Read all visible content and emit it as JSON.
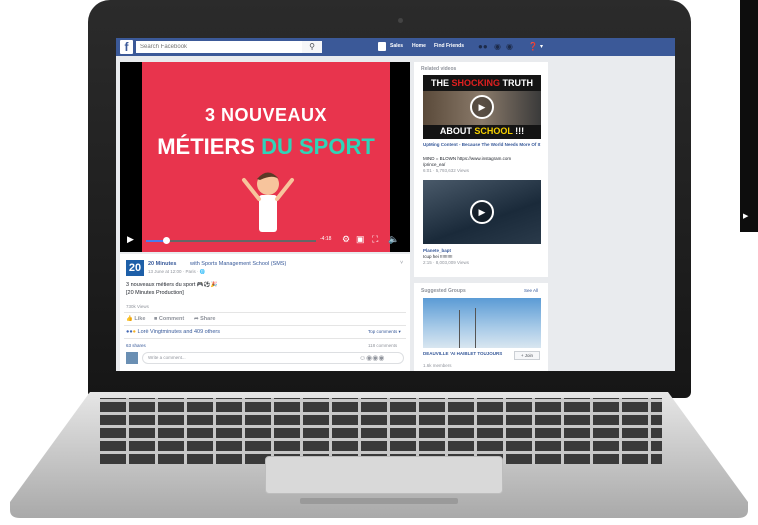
{
  "topbar": {
    "logo": "f",
    "search_placeholder": "Search Facebook",
    "search_icon": "search-icon",
    "user_label": "Sales",
    "home": "Home",
    "find_friends": "Find Friends"
  },
  "video": {
    "line1": "3 NOUVEAUX",
    "line2a": "MÉTIERS",
    "line2b": "DU SPORT",
    "time": "-4:18",
    "progress": 0.12
  },
  "post": {
    "page_logo": "20",
    "author": "20 Minutes",
    "with_text": "with Sports Management School (SMS)",
    "meta": "13 June at 12:00 · Paris · 🌐",
    "text1": "3 nouveaux métiers du sport 🎮⚽🎉",
    "text2": "[20 Minutes Production]",
    "views": "730k Views",
    "like": "Like",
    "comment": "Comment",
    "share": "Share",
    "reactions": "Lorè Vingtminutes and 409 others",
    "top_comments": "Top comments ▾",
    "shares": "63 shares",
    "comments_count": "118 comments",
    "write_comment": "Write a comment..."
  },
  "related": {
    "heading": "Related videos",
    "v1_top1": "THE ",
    "v1_top2": "SHOCKING",
    "v1_top3": " TRUTH",
    "v1_bottom1": "ABOUT ",
    "v1_bottom2": "SCHOOL",
    "v1_bottom3": " !!!",
    "v1_title": "UpMing Content - Because The World Needs More Of It",
    "v1_desc": "MIND = BLOWN https://www.instagram.com",
    "v1_desc2": "/prince_ea/",
    "v1_stats": "6:01 · 5,793,632 Views",
    "v2_title": "Planete_bapt",
    "v2_desc": "Icup hei !!!!!!!!!!",
    "v2_stats": "2:15 · 8,003,009 Views"
  },
  "groups": {
    "heading": "Suggested Groups",
    "see_all": "See All",
    "name": "DEAUVILLE 'AI HAIBLET TOUJOURS",
    "members": "1.6k members",
    "join": "+ Join"
  }
}
